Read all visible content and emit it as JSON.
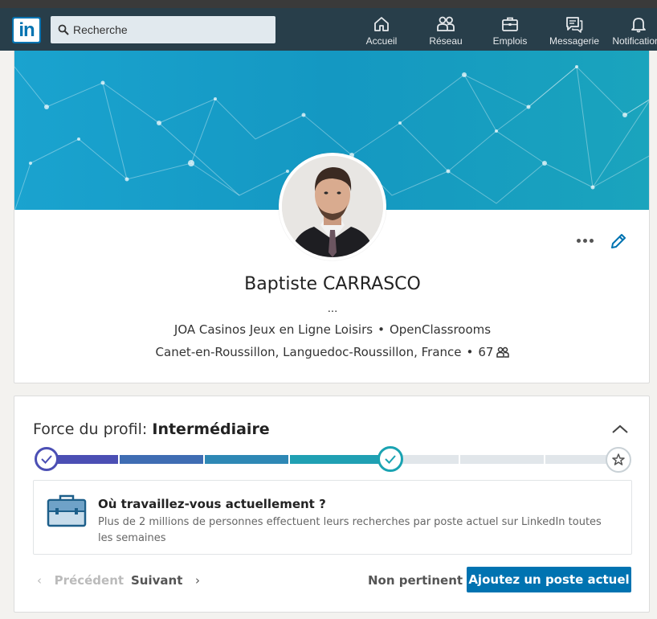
{
  "navbar": {
    "logo_text": "in",
    "search": {
      "placeholder": "Recherche"
    },
    "items": [
      {
        "label": "Accueil",
        "icon": "home-icon"
      },
      {
        "label": "Réseau",
        "icon": "network-icon"
      },
      {
        "label": "Emplois",
        "icon": "jobs-icon"
      },
      {
        "label": "Messagerie",
        "icon": "messaging-icon"
      },
      {
        "label": "Notifications",
        "icon": "bell-icon"
      }
    ]
  },
  "profile": {
    "name": "Baptiste CARRASCO",
    "headline": "...",
    "companies": [
      "JOA Casinos Jeux en Ligne Loisirs",
      "OpenClassrooms"
    ],
    "location": "Canet-en-Roussillon, Languedoc-Roussillon, France",
    "connections": "67",
    "separator": "•"
  },
  "strength": {
    "label": "Force du profil:",
    "level": "Intermédiaire",
    "progress_steps_completed": 4,
    "progress_steps_total": 7,
    "prompt_title": "Où travaillez-vous actuellement ?",
    "prompt_text": "Plus de 2 millions de personnes effectuent leurs recherches par poste actuel sur LinkedIn toutes les semaines",
    "prev_label": "Précédent",
    "next_label": "Suivant",
    "dismiss_label": "Non pertinent",
    "add_label": "Ajoutez un poste actuel"
  },
  "colors": {
    "navbar_bg": "#283e4a",
    "brand_blue": "#0073b1",
    "meter_start": "#4c4fb4",
    "meter_end": "#1aa3b2"
  }
}
